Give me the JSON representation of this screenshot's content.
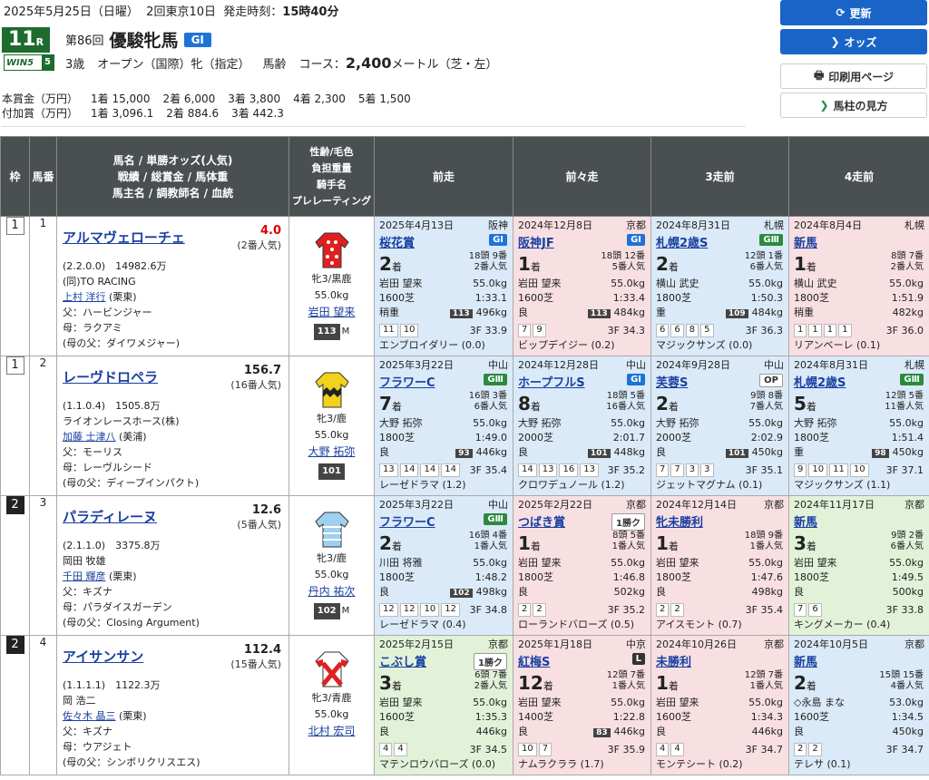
{
  "header": {
    "date": "2025年5月25日（日曜）",
    "meeting": "2回東京10日",
    "post_label": "発走時刻：",
    "post_time": "15時40分",
    "race_no": "11",
    "race_unit": "R",
    "win5_label": "WIN5",
    "win5_no": "5",
    "kai": "第86回",
    "race_name": "優駿牝馬",
    "grade": "GⅠ",
    "cond1": "3歳",
    "cond2": "オープン（国際）牝（指定）",
    "cond3": "馬齢",
    "course_label": "コース：",
    "distance": "2,400",
    "distance_unit": "メートル（芝・左）"
  },
  "prize": {
    "honsho_label": "本賞金（万円）",
    "honsho": [
      "1着",
      "15,000",
      "2着",
      "6,000",
      "3着",
      "3,800",
      "4着",
      "2,300",
      "5着",
      "1,500"
    ],
    "fuka_label": "付加賞（万円）",
    "fuka": [
      "1着",
      "3,096.1",
      "2着",
      "884.6",
      "3着",
      "442.3"
    ]
  },
  "buttons": {
    "update": "更新",
    "odds": "オッズ",
    "print": "印刷用ページ",
    "guide": "馬柱の見方"
  },
  "table_headers": {
    "waku": "枠",
    "uma": "馬番",
    "horse": [
      "馬名 / 単勝オッズ(人気)",
      "戦績 / 総賞金 / 馬体重",
      "馬主名 / 調教師名 / 血統"
    ],
    "jockey": [
      "性齢/毛色",
      "負担重量",
      "騎手名",
      "プレレーティング"
    ],
    "past": [
      "前走",
      "前々走",
      "3走前",
      "4走前"
    ]
  },
  "horses": [
    {
      "waku": "1",
      "uma": "1",
      "name": "アルマヴェローチェ",
      "odds": "4.0",
      "pop": "(2番人気)",
      "fav": true,
      "record": "(2.2.0.0)",
      "earnings": "14982.6万",
      "owner": "(同)TO RACING",
      "trainer": "上村 洋行",
      "stable": "(栗東)",
      "sire": "父：ハービンジャー",
      "dam": "母：ラクアミ",
      "damsire": "(母の父：ダイワメジャー)",
      "sexage": "牝3/黒鹿",
      "weight": "55.0kg",
      "jockey": "岩田 望来",
      "rating": "113",
      "mark": "M",
      "past": [
        {
          "date": "2025年4月13日",
          "track": "阪神",
          "race": "桜花賞",
          "grade": "GⅠ",
          "gcls": "g-blue",
          "rank": "2",
          "field": "18頭 9番",
          "pop": "2番人気",
          "jockey": "岩田 望来",
          "kg": "55.0kg",
          "course": "1600芝",
          "time": "1:33.1",
          "cond": "稍重",
          "rt": "113",
          "bw": "496kg",
          "corners": [
            "11",
            "10"
          ],
          "f3": "3F 33.9",
          "winner": "エンブロイダリー (0.0)",
          "color": "blue"
        },
        {
          "date": "2024年12月8日",
          "track": "京都",
          "race": "阪神JF",
          "grade": "GⅠ",
          "gcls": "g-blue",
          "rank": "1",
          "field": "18頭 12番",
          "pop": "5番人気",
          "jockey": "岩田 望来",
          "kg": "55.0kg",
          "course": "1600芝",
          "time": "1:33.4",
          "cond": "良",
          "rt": "113",
          "bw": "484kg",
          "corners": [
            "7",
            "9"
          ],
          "f3": "3F 34.3",
          "winner": "ビップデイジー (0.2)",
          "color": "pink"
        },
        {
          "date": "2024年8月31日",
          "track": "札幌",
          "race": "札幌2歳S",
          "grade": "GⅢ",
          "gcls": "g-green",
          "rank": "2",
          "field": "12頭 1番",
          "pop": "6番人気",
          "jockey": "横山 武史",
          "kg": "55.0kg",
          "course": "1800芝",
          "time": "1:50.3",
          "cond": "重",
          "rt": "109",
          "bw": "484kg",
          "corners": [
            "6",
            "6",
            "8",
            "5"
          ],
          "f3": "3F 36.3",
          "winner": "マジックサンズ (0.0)",
          "color": "blue"
        },
        {
          "date": "2024年8月4日",
          "track": "札幌",
          "race": "新馬",
          "grade": "",
          "gcls": "",
          "rank": "1",
          "field": "8頭 7番",
          "pop": "2番人気",
          "jockey": "横山 武史",
          "kg": "55.0kg",
          "course": "1800芝",
          "time": "1:51.9",
          "cond": "稍重",
          "rt": "",
          "bw": "482kg",
          "corners": [
            "1",
            "1",
            "1",
            "1"
          ],
          "f3": "3F 36.0",
          "winner": "リアンベーレ (0.1)",
          "color": "pink"
        }
      ]
    },
    {
      "waku": "1",
      "uma": "2",
      "name": "レーヴドロペラ",
      "odds": "156.7",
      "pop": "(16番人気)",
      "fav": false,
      "record": "(1.1.0.4)",
      "earnings": "1505.8万",
      "owner": "ライオンレースホース(株)",
      "trainer": "加藤 士津八",
      "stable": "(美浦)",
      "sire": "父：モーリス",
      "dam": "母：レーヴルシード",
      "damsire": "(母の父：ディープインパクト)",
      "sexage": "牝3/鹿",
      "weight": "55.0kg",
      "jockey": "大野 拓弥",
      "rating": "101",
      "mark": "",
      "past": [
        {
          "date": "2025年3月22日",
          "track": "中山",
          "race": "フラワーC",
          "grade": "GⅢ",
          "gcls": "g-green",
          "rank": "7",
          "field": "16頭 3番",
          "pop": "6番人気",
          "jockey": "大野 拓弥",
          "kg": "55.0kg",
          "course": "1800芝",
          "time": "1:49.0",
          "cond": "良",
          "rt": "93",
          "bw": "446kg",
          "corners": [
            "13",
            "14",
            "14",
            "14"
          ],
          "f3": "3F 35.4",
          "winner": "レーゼドラマ (1.2)",
          "color": "blue"
        },
        {
          "date": "2024年12月28日",
          "track": "中山",
          "race": "ホープフルS",
          "grade": "GⅠ",
          "gcls": "g-blue",
          "rank": "8",
          "field": "18頭 5番",
          "pop": "16番人気",
          "jockey": "大野 拓弥",
          "kg": "55.0kg",
          "course": "2000芝",
          "time": "2:01.7",
          "cond": "良",
          "rt": "101",
          "bw": "448kg",
          "corners": [
            "14",
            "13",
            "16",
            "13"
          ],
          "f3": "3F 35.2",
          "winner": "クロワデュノール (1.2)",
          "color": "blue"
        },
        {
          "date": "2024年9月28日",
          "track": "中山",
          "race": "芙蓉S",
          "grade": "OP",
          "gcls": "g-gray",
          "rank": "2",
          "field": "9頭 8番",
          "pop": "7番人気",
          "jockey": "大野 拓弥",
          "kg": "55.0kg",
          "course": "2000芝",
          "time": "2:02.9",
          "cond": "良",
          "rt": "101",
          "bw": "450kg",
          "corners": [
            "7",
            "7",
            "3",
            "3"
          ],
          "f3": "3F 35.1",
          "winner": "ジェットマグナム (0.1)",
          "color": "blue"
        },
        {
          "date": "2024年8月31日",
          "track": "札幌",
          "race": "札幌2歳S",
          "grade": "GⅢ",
          "gcls": "g-green",
          "rank": "5",
          "field": "12頭 5番",
          "pop": "11番人気",
          "jockey": "大野 拓弥",
          "kg": "55.0kg",
          "course": "1800芝",
          "time": "1:51.4",
          "cond": "重",
          "rt": "98",
          "bw": "450kg",
          "corners": [
            "9",
            "10",
            "11",
            "10"
          ],
          "f3": "3F 37.1",
          "winner": "マジックサンズ (1.1)",
          "color": "blue"
        }
      ]
    },
    {
      "waku": "2",
      "uma": "3",
      "name": "パラディレーヌ",
      "odds": "12.6",
      "pop": "(5番人気)",
      "fav": false,
      "record": "(2.1.1.0)",
      "earnings": "3375.8万",
      "owner": "岡田 牧雄",
      "trainer": "千田 輝彦",
      "stable": "(栗東)",
      "sire": "父：キズナ",
      "dam": "母：パラダイスガーデン",
      "damsire": "(母の父：Closing Argument)",
      "sexage": "牝3/鹿",
      "weight": "55.0kg",
      "jockey": "丹内 祐次",
      "rating": "102",
      "mark": "M",
      "past": [
        {
          "date": "2025年3月22日",
          "track": "中山",
          "race": "フラワーC",
          "grade": "GⅢ",
          "gcls": "g-green",
          "rank": "2",
          "field": "16頭 4番",
          "pop": "1番人気",
          "jockey": "川田 将雅",
          "kg": "55.0kg",
          "course": "1800芝",
          "time": "1:48.2",
          "cond": "良",
          "rt": "102",
          "bw": "498kg",
          "corners": [
            "12",
            "12",
            "10",
            "12"
          ],
          "f3": "3F 34.8",
          "winner": "レーゼドラマ (0.4)",
          "color": "blue"
        },
        {
          "date": "2025年2月22日",
          "track": "京都",
          "race": "つばき賞",
          "grade": "1勝ク",
          "gcls": "g-gray",
          "rank": "1",
          "field": "8頭 5番",
          "pop": "1番人気",
          "jockey": "岩田 望来",
          "kg": "55.0kg",
          "course": "1800芝",
          "time": "1:46.8",
          "cond": "良",
          "rt": "",
          "bw": "502kg",
          "corners": [
            "2",
            "2"
          ],
          "f3": "3F 35.2",
          "winner": "ローランドバローズ (0.5)",
          "color": "pink"
        },
        {
          "date": "2024年12月14日",
          "track": "京都",
          "race": "牝未勝利",
          "grade": "",
          "gcls": "",
          "rank": "1",
          "field": "18頭 9番",
          "pop": "1番人気",
          "jockey": "岩田 望来",
          "kg": "55.0kg",
          "course": "1800芝",
          "time": "1:47.6",
          "cond": "良",
          "rt": "",
          "bw": "498kg",
          "corners": [
            "2",
            "2"
          ],
          "f3": "3F 35.4",
          "winner": "アイスモント (0.7)",
          "color": "pink"
        },
        {
          "date": "2024年11月17日",
          "track": "京都",
          "race": "新馬",
          "grade": "",
          "gcls": "",
          "rank": "3",
          "field": "9頭 2番",
          "pop": "6番人気",
          "jockey": "岩田 望来",
          "kg": "55.0kg",
          "course": "1800芝",
          "time": "1:49.5",
          "cond": "良",
          "rt": "",
          "bw": "500kg",
          "corners": [
            "7",
            "6"
          ],
          "f3": "3F 33.8",
          "winner": "キングメーカー (0.4)",
          "color": "green"
        }
      ]
    },
    {
      "waku": "2",
      "uma": "4",
      "name": "アイサンサン",
      "odds": "112.4",
      "pop": "(15番人気)",
      "fav": false,
      "record": "(1.1.1.1)",
      "earnings": "1122.3万",
      "owner": "岡 浩二",
      "trainer": "佐々木 晶三",
      "stable": "(栗東)",
      "sire": "父：キズナ",
      "dam": "母：ウアジェト",
      "damsire": "(母の父：シンボリクリスエス)",
      "sexage": "牝3/青鹿",
      "weight": "55.0kg",
      "jockey": "北村 宏司",
      "rating": "",
      "mark": "",
      "past": [
        {
          "date": "2025年2月15日",
          "track": "京都",
          "race": "こぶし賞",
          "grade": "1勝ク",
          "gcls": "g-gray",
          "rank": "3",
          "field": "6頭 7番",
          "pop": "2番人気",
          "jockey": "岩田 望来",
          "kg": "55.0kg",
          "course": "1600芝",
          "time": "1:35.3",
          "cond": "良",
          "rt": "",
          "bw": "446kg",
          "corners": [
            "4",
            "4"
          ],
          "f3": "3F 34.5",
          "winner": "マテンロウバローズ (0.0)",
          "color": "green"
        },
        {
          "date": "2025年1月18日",
          "track": "中京",
          "race": "紅梅S",
          "grade": "L",
          "gcls": "g-dark",
          "rank": "12",
          "field": "12頭 7番",
          "pop": "1番人気",
          "jockey": "岩田 望来",
          "kg": "55.0kg",
          "course": "1400芝",
          "time": "1:22.8",
          "cond": "良",
          "rt": "83",
          "bw": "446kg",
          "corners": [
            "10",
            "7"
          ],
          "f3": "3F 35.9",
          "winner": "ナムラクララ (1.7)",
          "color": "pink"
        },
        {
          "date": "2024年10月26日",
          "track": "京都",
          "race": "未勝利",
          "grade": "",
          "gcls": "",
          "rank": "1",
          "field": "12頭 7番",
          "pop": "1番人気",
          "jockey": "岩田 望来",
          "kg": "55.0kg",
          "course": "1600芝",
          "time": "1:34.3",
          "cond": "良",
          "rt": "",
          "bw": "446kg",
          "corners": [
            "4",
            "4"
          ],
          "f3": "3F 34.7",
          "winner": "モンテシート (0.2)",
          "color": "pink"
        },
        {
          "date": "2024年10月5日",
          "track": "京都",
          "race": "新馬",
          "grade": "",
          "gcls": "",
          "rank": "2",
          "field": "15頭 15番",
          "pop": "4番人気",
          "jockey": "◇永島 まな",
          "kg": "53.0kg",
          "course": "1600芝",
          "time": "1:34.5",
          "cond": "良",
          "rt": "",
          "bw": "450kg",
          "corners": [
            "2",
            "2"
          ],
          "f3": "3F 34.7",
          "winner": "テレサ (0.1)",
          "color": "blue"
        }
      ]
    }
  ]
}
